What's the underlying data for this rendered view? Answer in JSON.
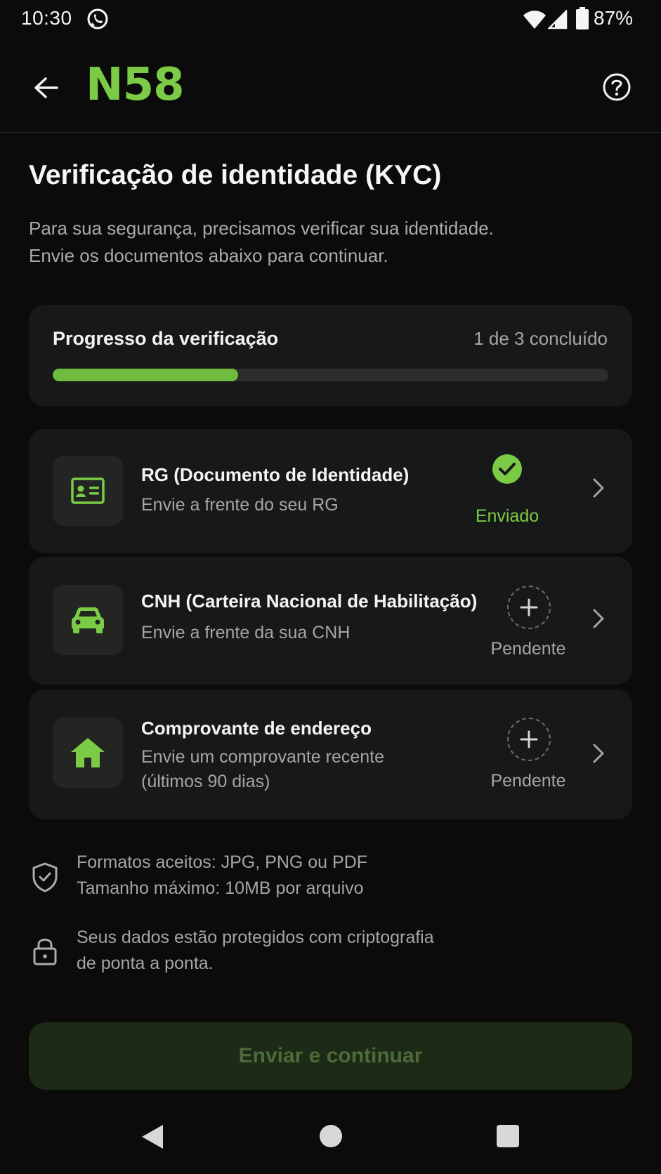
{
  "status_bar": {
    "time": "10:30",
    "battery_percent": "87%",
    "icons": [
      "whatsapp-icon",
      "wifi-icon",
      "signal-icon",
      "battery-icon"
    ]
  },
  "header": {
    "logo": "N58",
    "back_icon": "arrow-left-icon",
    "help_icon": "help-circle-icon"
  },
  "page": {
    "title": "Verificação de identidade (KYC)",
    "subtitle_line1": "Para sua segurança, precisamos verificar sua identidade.",
    "subtitle_line2": "Envie os documentos abaixo para continuar."
  },
  "progress": {
    "label": "Progresso da verificação",
    "count_text": "1 de 3 concluído",
    "completed": 1,
    "total": 3
  },
  "documents": [
    {
      "icon": "id-card-icon",
      "title": "RG (Documento de Identidade)",
      "description_line1": "Envie a frente do seu RG",
      "description_line2": "",
      "status": "Enviado",
      "status_icon": "check-circle-icon"
    },
    {
      "icon": "car-icon",
      "title": "CNH (Carteira Nacional de Habilitação)",
      "description_line1": "Envie a frente da sua CNH",
      "description_line2": "",
      "status": "Pendente",
      "status_icon": "plus-circle-icon"
    },
    {
      "icon": "house-icon",
      "title": "Comprovante de endereço",
      "description_line1": "Envie um comprovante recente",
      "description_line2": "(últimos 90 dias)",
      "status": "Pendente",
      "status_icon": "plus-circle-icon"
    }
  ],
  "info": [
    {
      "icon": "shield-check-icon",
      "line1": "Formatos aceitos: JPG, PNG ou PDF",
      "line2": "Tamanho máximo: 10MB por arquivo"
    },
    {
      "icon": "lock-icon",
      "line1": "Seus dados estão protegidos com criptografia",
      "line2": "de ponta a ponta."
    }
  ],
  "cta": {
    "label": "Enviar e continuar"
  },
  "colors": {
    "accent": "#7ccb46",
    "progress_fill": "#6fbb3f",
    "sent_status": "#7ccb46",
    "pending_status": "#a3a6a3",
    "cta_background_disabled": "#1d2b16"
  },
  "nav_bar": {
    "icons": [
      "nav-back-icon",
      "nav-home-icon",
      "nav-recents-icon"
    ]
  }
}
